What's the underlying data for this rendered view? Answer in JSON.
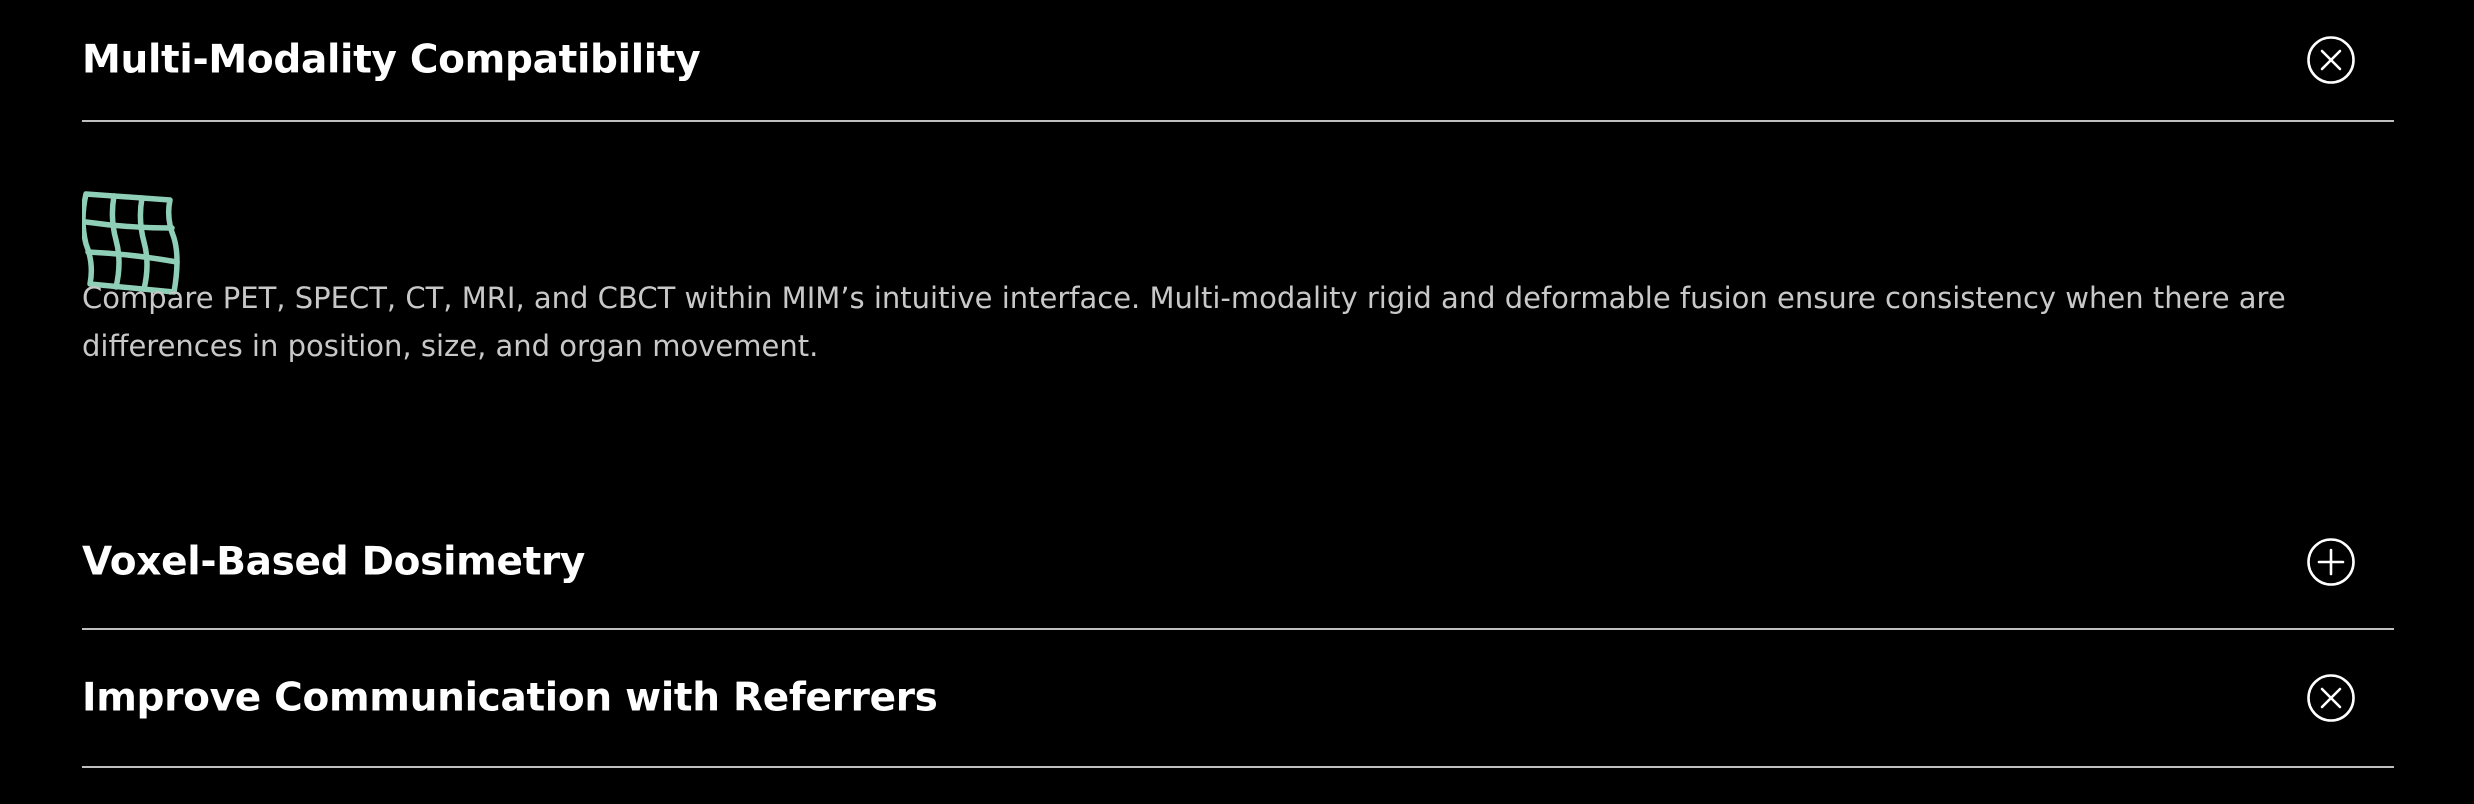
{
  "accordion": {
    "items": [
      {
        "title": "Multi-Modality Compatibility",
        "state": "expanded",
        "toggle_icon": "close-circle-icon",
        "panel": {
          "icon": "deformable-grid-icon",
          "icon_color": "#8fcfb8",
          "text": "Compare PET, SPECT, CT, MRI, and CBCT within MIM’s intuitive interface. Multi-modality rigid and deformable fusion ensure consistency when there are differences in position, size, and organ movement."
        }
      },
      {
        "title": "Voxel-Based Dosimetry",
        "state": "collapsed",
        "toggle_icon": "plus-circle-icon"
      },
      {
        "title": "Improve Communication with Referrers",
        "state": "collapsed",
        "toggle_icon": "close-circle-icon"
      }
    ]
  },
  "colors": {
    "background": "#000000",
    "title_text": "#ffffff",
    "body_text": "#c8c8c8",
    "divider": "#bfbfbf",
    "accent": "#8fcfb8"
  }
}
